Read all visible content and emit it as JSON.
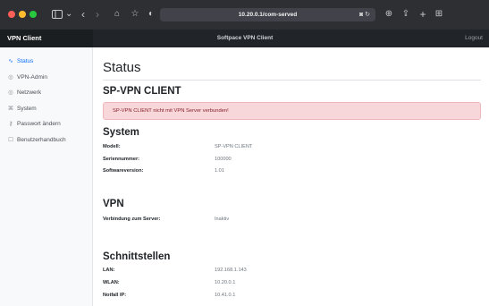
{
  "browser": {
    "url": "10.20.0.1/com-served",
    "colors": {
      "titlebar": "#2e2f33",
      "close": "#ff5f57",
      "minimize": "#febc2e",
      "maximize": "#28c840"
    }
  },
  "navbar": {
    "brand": "VPN Client",
    "title": "Softpace VPN Client",
    "logout": "Logout"
  },
  "sidebar": {
    "items": [
      {
        "label": "Status",
        "icon": "pulse-icon",
        "glyph": "∿",
        "active": true
      },
      {
        "label": "VPN-Admin",
        "icon": "globe-icon",
        "glyph": "◎",
        "active": false
      },
      {
        "label": "Netzwerk",
        "icon": "network-icon",
        "glyph": "◎",
        "active": false
      },
      {
        "label": "System",
        "icon": "gear-icon",
        "glyph": "⌘",
        "active": false
      },
      {
        "label": "Passwort ändern",
        "icon": "key-icon",
        "glyph": "⚷",
        "active": false
      },
      {
        "label": "Benutzerhandbuch",
        "icon": "book-icon",
        "glyph": "☐",
        "active": false
      }
    ]
  },
  "main": {
    "page_title": "Status",
    "client_heading": "SP-VPN CLIENT",
    "alert_text": "SP-VPN CLIENT nicht mit VPN Server verbunden!",
    "system": {
      "heading": "System",
      "rows": [
        {
          "label": "Modell:",
          "value": "SP-VPN CLIENT"
        },
        {
          "label": "Seriennummer:",
          "value": "100000"
        },
        {
          "label": "Softwareversion:",
          "value": "1.01"
        }
      ]
    },
    "vpn": {
      "heading": "VPN",
      "rows": [
        {
          "label": "Verbindung zum Server:",
          "value": "Inaktiv"
        }
      ]
    },
    "interfaces": {
      "heading": "Schnittstellen",
      "rows": [
        {
          "label": "LAN:",
          "value": "192.168.1.143"
        },
        {
          "label": "WLAN:",
          "value": "10.20.0.1"
        },
        {
          "label": "Notfall IP:",
          "value": "10.41.0.1"
        }
      ]
    }
  }
}
